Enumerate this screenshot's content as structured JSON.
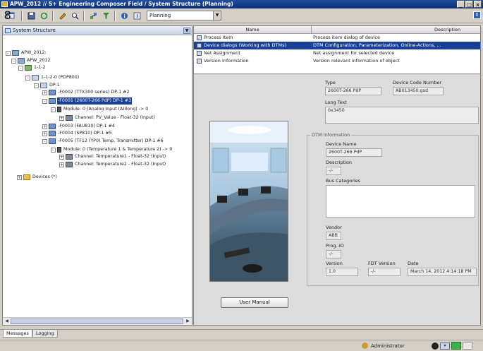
{
  "window": {
    "title": "APW_2012 // S+ Engineering Composer Field / System Structure (Planning)",
    "buttons": [
      "_",
      "□",
      "×"
    ]
  },
  "callout": "8",
  "toolbar": {
    "icons": [
      "new-icon",
      "save-icon",
      "refresh-icon",
      "edit-icon",
      "search-icon",
      "network-icon",
      "filter-icon",
      "info-icon",
      "help-icon"
    ],
    "mode_value": "Planning"
  },
  "left_pane": {
    "title": "System Structure",
    "tree": [
      {
        "label": "APW_2012:",
        "icon": "proj",
        "exp": "-"
      },
      {
        "label": "APW_2012",
        "icon": "proj",
        "exp": "-"
      },
      {
        "label": "1-1-2",
        "icon": "net",
        "exp": "-"
      },
      {
        "label": "1-1-2-0 (PDP800)",
        "icon": "bus",
        "exp": "-"
      },
      {
        "label": "DP-1",
        "icon": "bus",
        "exp": "-"
      },
      {
        "label": "-F0002 (TTX300 series) DP-1 #2",
        "icon": "dev",
        "exp": "+"
      },
      {
        "label": "-F0001 (2600T-266 PdP) DP-1 #3",
        "icon": "dev",
        "exp": "-",
        "selected": true
      },
      {
        "label": "Module: 0 (Analog Input (AI)long) -> 0",
        "icon": "mod",
        "exp": "-"
      },
      {
        "label": "Channel: PV_Value - Float-32 (Input)",
        "icon": "chan",
        "exp": "+"
      },
      {
        "label": "-F0003 (FAU810) DP-1 #4",
        "icon": "dev",
        "exp": "+"
      },
      {
        "label": "-F0004 (SP810) DP-1 #5",
        "icon": "dev",
        "exp": "+"
      },
      {
        "label": "-F0005 (TF12 (YP0) Temp. Transmitter) DP-1 #6",
        "icon": "dev",
        "exp": "-"
      },
      {
        "label": "Module: 0 (Temperature 1 & Temperature 2) -> 0",
        "icon": "mod",
        "exp": "-"
      },
      {
        "label": "Channel: Temperature1 - Float-32 (Input)",
        "icon": "chan",
        "exp": "+"
      },
      {
        "label": "Channel: Temperature2 - Float-32 (Input)",
        "icon": "chan",
        "exp": "+"
      },
      {
        "label": "Devices (*)",
        "icon": "folder",
        "exp": "+"
      }
    ]
  },
  "list": {
    "col_name": "Name",
    "col_desc": "Description",
    "rows": [
      {
        "name": "Process Item",
        "desc": "Process item dialog of device"
      },
      {
        "name": "Device dialogs (Working with DTMs)",
        "desc": "DTM Configuration, Parameterization, Online-Actions, ...",
        "selected": true
      },
      {
        "name": "Net Assignment",
        "desc": "Net assignment for selected device"
      },
      {
        "name": "Version Information",
        "desc": "Version relevant information of object"
      }
    ]
  },
  "details": {
    "type_label": "Type",
    "type_value": "2600T-266 PdP",
    "code_label": "Device Code Number",
    "code_value": "AB013450.gsd",
    "longtext_label": "Long Text",
    "longtext_value": "0x3450",
    "dtm_title": "DTM Information",
    "device_name_label": "Device Name",
    "device_name_value": "2600T-266 PdP",
    "description_label": "Description",
    "description_value": "-/-",
    "bus_categories_label": "Bus Categories",
    "vendor_label": "Vendor",
    "vendor_value": "ABB",
    "progid_label": "Prog.-ID",
    "progid_value": "-/-",
    "version_label": "Version",
    "version_value": "1.0",
    "fdt_label": "FDT Version",
    "fdt_value": "-/-",
    "date_label": "Date",
    "date_value": "March 14, 2012 4:14:18 PM",
    "manual_button": "User Manual"
  },
  "bottom_tabs": [
    "Messages",
    "Logging"
  ],
  "status": {
    "user": "Administrator"
  }
}
